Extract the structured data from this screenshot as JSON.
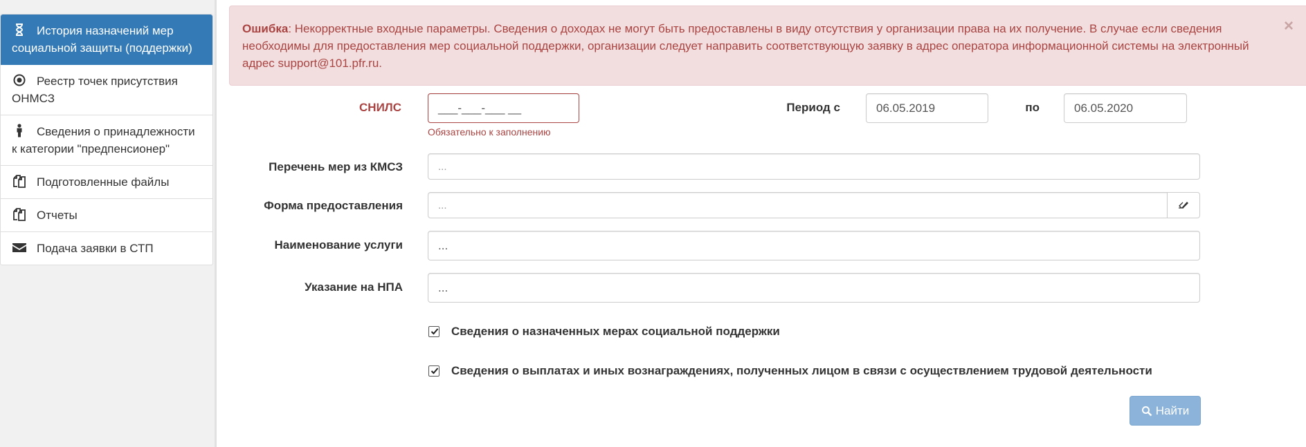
{
  "sidebar": {
    "items": [
      {
        "label": "История назначений мер социальной защиты (поддержки)",
        "icon": "hourglass-icon",
        "active": true
      },
      {
        "label": "Реестр точек присутствия ОНМСЗ",
        "icon": "target-icon",
        "active": false
      },
      {
        "label": "Сведения о принадлежности к категории \"предпенсионер\"",
        "icon": "person-icon",
        "active": false
      },
      {
        "label": "Подготовленные файлы",
        "icon": "copy-icon",
        "active": false
      },
      {
        "label": "Отчеты",
        "icon": "copy-icon",
        "active": false
      },
      {
        "label": "Подача заявки в СТП",
        "icon": "envelope-icon",
        "active": false
      }
    ]
  },
  "alert": {
    "title": "Ошибка",
    "message": ": Некорректные входные параметры. Сведения о доходах не могут быть предоставлены в виду отсутствия у организации права на их получение. В случае если сведения необходимы для предоставления мер социальной поддержки, организации следует направить соответствующую заявку в адрес оператора информационной системы на электронный адрес support@101.pfr.ru.",
    "close": "×"
  },
  "form": {
    "snils_label": "СНИЛС",
    "snils_value": "___-___-___ __",
    "snils_error": "Обязательно к заполнению",
    "period_from_label": "Период с",
    "period_from_value": "06.05.2019",
    "period_to_label": "по",
    "period_to_value": "06.05.2020",
    "measures_label": "Перечень мер из КМСЗ",
    "measures_placeholder": "...",
    "form_label": "Форма предоставления",
    "form_placeholder": "...",
    "service_label": "Наименование услуги",
    "service_value": "...",
    "npa_label": "Указание на НПА",
    "npa_value": "...",
    "check1_label": "Сведения о назначенных мерах социальной поддержки",
    "check1_checked": true,
    "check2_label": "Сведения о выплатах и иных вознаграждениях, полученных лицом в связи с осуществлением трудовой деятельности",
    "check2_checked": true,
    "find_button": "Найти"
  },
  "colors": {
    "primary": "#337ab7",
    "danger": "#a94442",
    "alert_bg": "#f2dede",
    "button_disabled": "#8cb3d9"
  }
}
